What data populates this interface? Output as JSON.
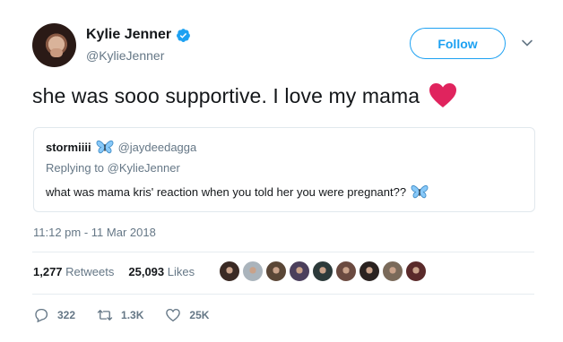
{
  "author": {
    "name": "Kylie Jenner",
    "handle": "@KylieJenner",
    "verified": true,
    "verified_color": "#1da1f2"
  },
  "follow_label": "Follow",
  "tweet": {
    "text": "she was sooo supportive. I love my mama",
    "emoji": "red-heart"
  },
  "quoted": {
    "name": "stormiiii",
    "name_emoji": "butterfly",
    "handle": "@jaydeedagga",
    "replying_prefix": "Replying to",
    "replying_to": "@KylieJenner",
    "text": "what was mama kris' reaction when you told her you were pregnant??",
    "text_emoji": "butterfly"
  },
  "timestamp": "11:12 pm - 11 Mar 2018",
  "stats": {
    "retweets_count": "1,277",
    "retweets_label": "Retweets",
    "likes_count": "25,093",
    "likes_label": "Likes"
  },
  "likers": [
    "#3a2a24",
    "#aab4bc",
    "#5a4636",
    "#4b3f5c",
    "#2c3a3a",
    "#6b4a40",
    "#2a2220",
    "#7a6a5a",
    "#5a2a2a"
  ],
  "actions": {
    "replies": "322",
    "retweets": "1.3K",
    "likes": "25K"
  },
  "colors": {
    "accent": "#1da1f2",
    "text": "#14171a",
    "muted": "#657786",
    "heart": "#e0245e"
  }
}
